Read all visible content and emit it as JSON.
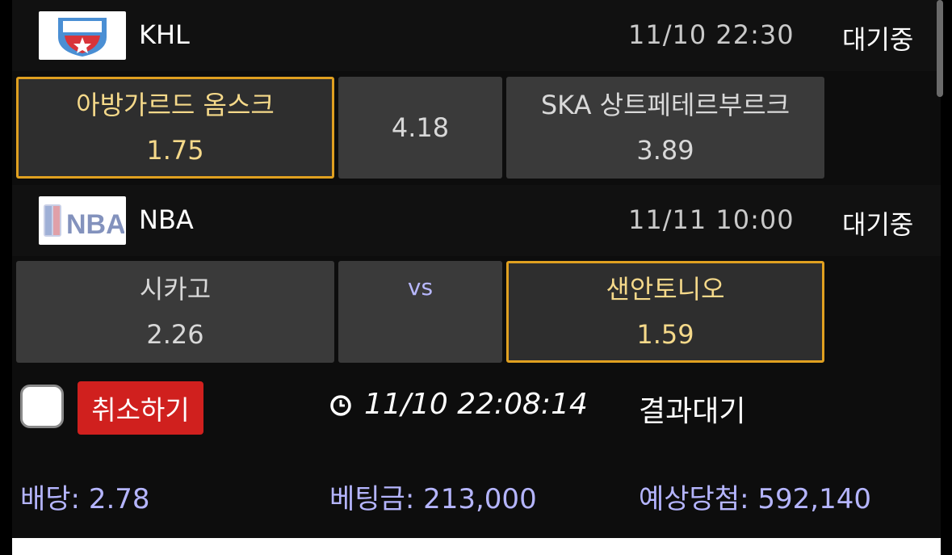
{
  "games": [
    {
      "league": "KHL",
      "logo_icon": "khl-logo-icon",
      "datetime": "11/10 22:30",
      "status": "대기중",
      "home": {
        "name": "아방가르드 옴스크",
        "odd": "1.75",
        "selected": true
      },
      "middle": {
        "label": "4.18",
        "selected": false
      },
      "away": {
        "name": "SKA 상트페테르부르크",
        "odd": "3.89",
        "selected": false
      }
    },
    {
      "league": "NBA",
      "logo_icon": "nba-logo-icon",
      "datetime": "11/11 10:00",
      "status": "대기중",
      "home": {
        "name": "시카고",
        "odd": "2.26",
        "selected": false
      },
      "middle": {
        "label": "vs",
        "selected": false
      },
      "away": {
        "name": "샌안토니오",
        "odd": "1.59",
        "selected": true
      }
    }
  ],
  "footer": {
    "cancel_label": "취소하기",
    "bet_time": "11/10 22:08:14",
    "result_status": "결과대기",
    "odds_summary": "배당: 2.78",
    "stake_summary": "베팅금: 213,000",
    "expected_win": "예상당첨: 592,140"
  },
  "colors": {
    "selected_border": "#e0a020",
    "selected_text": "#f5d98a",
    "cancel_button": "#d0201e",
    "summary_text": "#b5b5ff"
  }
}
